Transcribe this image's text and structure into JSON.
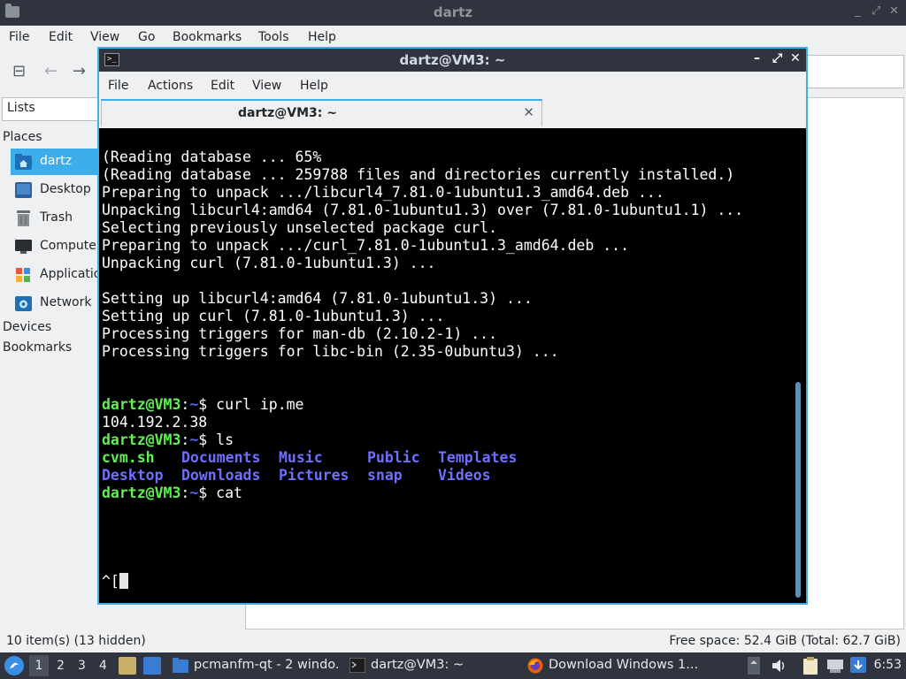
{
  "file_manager": {
    "title": "dartz",
    "window_controls": [
      "_",
      "⤢",
      "✕"
    ],
    "menu": [
      "File",
      "Edit",
      "View",
      "Go",
      "Bookmarks",
      "Tools",
      "Help"
    ],
    "lists_label": "Lists",
    "places_header": "Places",
    "places": [
      {
        "label": "dartz",
        "icon": "home-folder-icon",
        "selected": true
      },
      {
        "label": "Desktop",
        "icon": "desktop-icon",
        "selected": false
      },
      {
        "label": "Trash",
        "icon": "trash-icon",
        "selected": false
      },
      {
        "label": "Computer",
        "icon": "computer-icon",
        "selected": false
      },
      {
        "label": "Applications",
        "icon": "applications-icon",
        "selected": false
      },
      {
        "label": "Network",
        "icon": "network-icon",
        "selected": false
      }
    ],
    "devices_header": "Devices",
    "bookmarks_header": "Bookmarks",
    "status_left": "10 item(s) (13 hidden)",
    "status_right": "Free space: 52.4 GiB (Total: 62.7 GiB)"
  },
  "terminal": {
    "title": "dartz@VM3: ~",
    "menu": [
      "File",
      "Actions",
      "Edit",
      "View",
      "Help"
    ],
    "tab_label": "dartz@VM3: ~",
    "output": [
      "(Reading database ... 65%",
      "(Reading database ... 259788 files and directories currently installed.)",
      "Preparing to unpack .../libcurl4_7.81.0-1ubuntu1.3_amd64.deb ...",
      "Unpacking libcurl4:amd64 (7.81.0-1ubuntu1.3) over (7.81.0-1ubuntu1.1) ...",
      "Selecting previously unselected package curl.",
      "Preparing to unpack .../curl_7.81.0-1ubuntu1.3_amd64.deb ...",
      "Unpacking curl (7.81.0-1ubuntu1.3) ...",
      "Setting up libcurl4:amd64 (7.81.0-1ubuntu1.3) ...",
      "Setting up curl (7.81.0-1ubuntu1.3) ...",
      "Processing triggers for man-db (2.10.2-1) ...",
      "Processing triggers for libc-bin (2.35-0ubuntu3) ..."
    ],
    "prompt_user": "dartz@VM3",
    "prompt_colon": ":",
    "prompt_path": "~",
    "prompt_dollar": "$ ",
    "cmd1": "curl ip.me",
    "cmd1_output": "104.192.2.38",
    "cmd2": "ls",
    "ls_row1": [
      "cvm.sh",
      "Documents",
      "Music",
      "Public",
      "Templates"
    ],
    "ls_row2": [
      "Desktop",
      "Downloads",
      "Pictures",
      "snap",
      "Videos"
    ],
    "cmd3": "cat",
    "escape_seq": "^["
  },
  "taskbar": {
    "workspaces": [
      "1",
      "2",
      "3",
      "4"
    ],
    "tasks": [
      {
        "label": "pcmanfm-qt - 2 windo...",
        "icon": "folder-icon"
      },
      {
        "label": "dartz@VM3: ~",
        "icon": "terminal-icon"
      },
      {
        "label": "Download Windows 1...",
        "icon": "firefox-icon"
      }
    ],
    "clock": "6:53"
  }
}
